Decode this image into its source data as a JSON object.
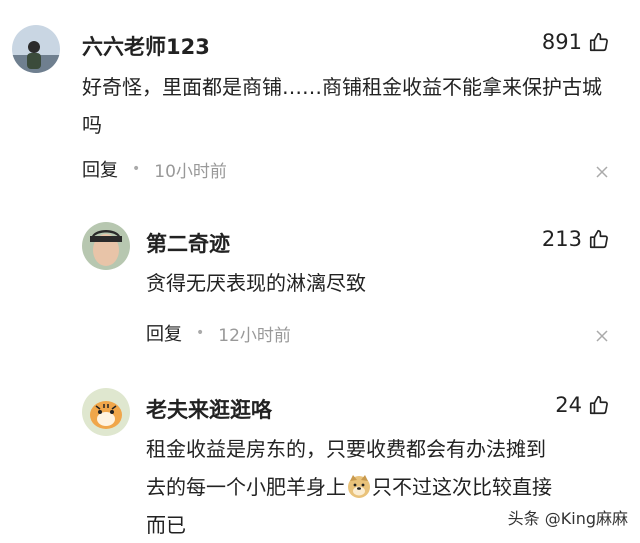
{
  "comments": [
    {
      "username": "六六老师123",
      "likes": "891",
      "text": "好奇怪，里面都是商铺……商铺租金收益不能拿来保护古城吗",
      "reply_label": "回复",
      "time": "10小时前",
      "icons": {
        "like": "thumbs-up-icon",
        "close": "close-icon"
      }
    },
    {
      "username": "第二奇迹",
      "likes": "213",
      "text": "贪得无厌表现的淋漓尽致",
      "reply_label": "回复",
      "time": "12小时前",
      "icons": {
        "like": "thumbs-up-icon",
        "close": "close-icon"
      }
    },
    {
      "username": "老夫来逛逛咯",
      "likes": "24",
      "text_line1": "租金收益是房东的，只要收费都会有办法摊到",
      "text_line2a": "去的每一个小肥羊身上",
      "text_line2b": "只不过这次比较直接",
      "text_line3": "而已",
      "icons": {
        "like": "thumbs-up-icon",
        "emoji": "doge-emoji-icon"
      }
    }
  ],
  "watermark": "头条 @King麻麻"
}
